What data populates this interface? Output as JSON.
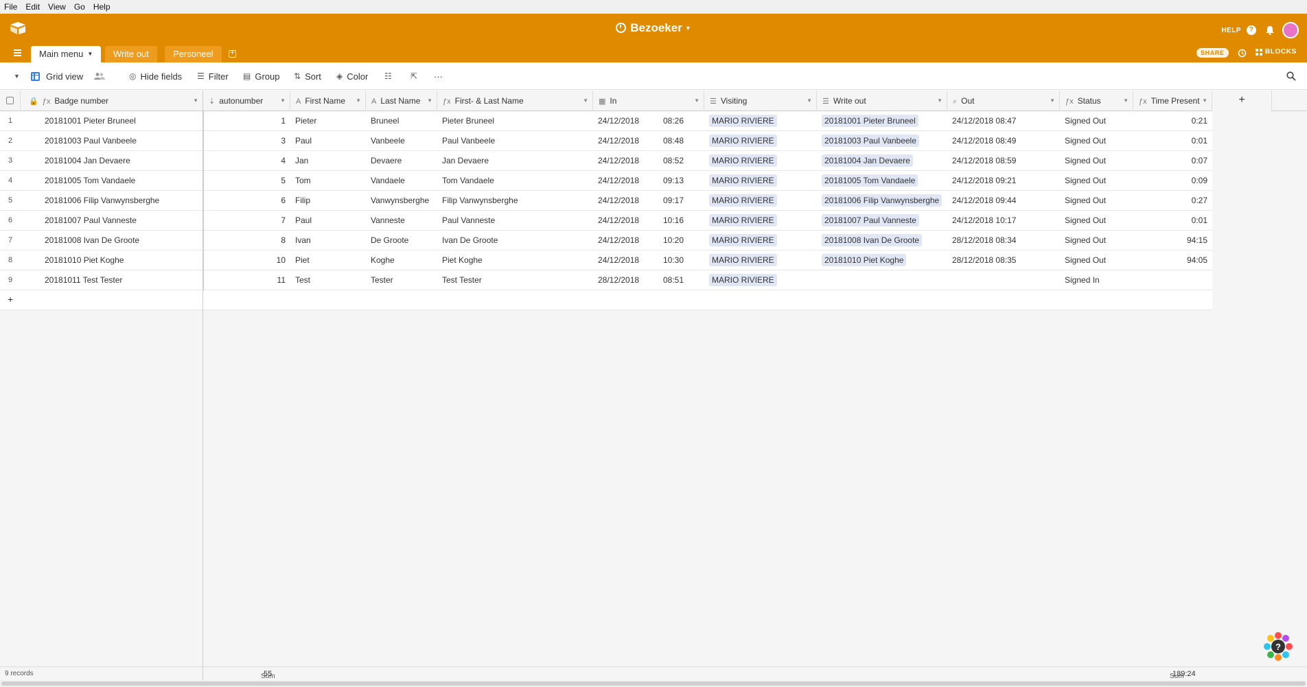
{
  "menubar": [
    "File",
    "Edit",
    "View",
    "Go",
    "Help"
  ],
  "header": {
    "base_name": "Bezoeker",
    "help_label": "HELP",
    "share_label": "SHARE",
    "blocks_label": "BLOCKS",
    "accent_color": "#e08a00"
  },
  "tabs": [
    {
      "label": "Main menu",
      "active": true
    },
    {
      "label": "Write out",
      "active": false
    },
    {
      "label": "Personeel",
      "active": false
    }
  ],
  "viewbar": {
    "view_name": "Grid view",
    "hide_fields": "Hide fields",
    "filter": "Filter",
    "group": "Group",
    "sort": "Sort",
    "color": "Color",
    "more": "···"
  },
  "columns": [
    {
      "label": "Badge number",
      "icon": "fx"
    },
    {
      "label": "autonumber",
      "icon": "autonumber"
    },
    {
      "label": "First Name",
      "icon": "A"
    },
    {
      "label": "Last Name",
      "icon": "A"
    },
    {
      "label": "First- & Last Name",
      "icon": "fx"
    },
    {
      "label": "In",
      "icon": "date"
    },
    {
      "label": "Visiting",
      "icon": "link"
    },
    {
      "label": "Write out",
      "icon": "link"
    },
    {
      "label": "Out",
      "icon": "lookup"
    },
    {
      "label": "Status",
      "icon": "fx"
    },
    {
      "label": "Time Present",
      "icon": "fx"
    }
  ],
  "rows": [
    {
      "n": "1",
      "badge": "20181001 Pieter Bruneel",
      "auto": "1",
      "first": "Pieter",
      "last": "Bruneel",
      "full": "Pieter Bruneel",
      "in_date": "24/12/2018",
      "in_time": "08:26",
      "visiting": "MARIO RIVIERE",
      "writeout": "20181001 Pieter Bruneel",
      "out": "24/12/2018 08:47",
      "status": "Signed Out",
      "present": "0:21"
    },
    {
      "n": "2",
      "badge": "20181003 Paul Vanbeele",
      "auto": "3",
      "first": "Paul",
      "last": "Vanbeele",
      "full": "Paul Vanbeele",
      "in_date": "24/12/2018",
      "in_time": "08:48",
      "visiting": "MARIO RIVIERE",
      "writeout": "20181003 Paul Vanbeele",
      "out": "24/12/2018 08:49",
      "status": "Signed Out",
      "present": "0:01"
    },
    {
      "n": "3",
      "badge": "20181004 Jan Devaere",
      "auto": "4",
      "first": "Jan",
      "last": "Devaere",
      "full": "Jan Devaere",
      "in_date": "24/12/2018",
      "in_time": "08:52",
      "visiting": "MARIO RIVIERE",
      "writeout": "20181004 Jan Devaere",
      "out": "24/12/2018 08:59",
      "status": "Signed Out",
      "present": "0:07"
    },
    {
      "n": "4",
      "badge": "20181005 Tom Vandaele",
      "auto": "5",
      "first": "Tom",
      "last": "Vandaele",
      "full": "Tom Vandaele",
      "in_date": "24/12/2018",
      "in_time": "09:13",
      "visiting": "MARIO RIVIERE",
      "writeout": "20181005 Tom Vandaele",
      "out": "24/12/2018 09:21",
      "status": "Signed Out",
      "present": "0:09"
    },
    {
      "n": "5",
      "badge": "20181006 Filip Vanwynsberghe",
      "auto": "6",
      "first": "Filip",
      "last": "Vanwynsberghe",
      "full": "Filip Vanwynsberghe",
      "in_date": "24/12/2018",
      "in_time": "09:17",
      "visiting": "MARIO RIVIERE",
      "writeout": "20181006 Filip Vanwynsberghe",
      "out": "24/12/2018 09:44",
      "status": "Signed Out",
      "present": "0:27"
    },
    {
      "n": "6",
      "badge": "20181007 Paul Vanneste",
      "auto": "7",
      "first": "Paul",
      "last": "Vanneste",
      "full": "Paul Vanneste",
      "in_date": "24/12/2018",
      "in_time": "10:16",
      "visiting": "MARIO RIVIERE",
      "writeout": "20181007 Paul Vanneste",
      "out": "24/12/2018 10:17",
      "status": "Signed Out",
      "present": "0:01"
    },
    {
      "n": "7",
      "badge": "20181008 Ivan De Groote",
      "auto": "8",
      "first": "Ivan",
      "last": "De Groote",
      "full": "Ivan De Groote",
      "in_date": "24/12/2018",
      "in_time": "10:20",
      "visiting": "MARIO RIVIERE",
      "writeout": "20181008 Ivan De Groote",
      "out": "28/12/2018 08:34",
      "status": "Signed Out",
      "present": "94:15"
    },
    {
      "n": "8",
      "badge": "20181010 Piet Koghe",
      "auto": "10",
      "first": "Piet",
      "last": "Koghe",
      "full": "Piet Koghe",
      "in_date": "24/12/2018",
      "in_time": "10:30",
      "visiting": "MARIO RIVIERE",
      "writeout": "20181010 Piet Koghe",
      "out": "28/12/2018 08:35",
      "status": "Signed Out",
      "present": "94:05"
    },
    {
      "n": "9",
      "badge": "20181011 Test Tester",
      "auto": "11",
      "first": "Test",
      "last": "Tester",
      "full": "Test Tester",
      "in_date": "28/12/2018",
      "in_time": "08:51",
      "visiting": "MARIO RIVIERE",
      "writeout": "",
      "out": "",
      "status": "Signed In",
      "present": ""
    }
  ],
  "footer": {
    "records": "9 records",
    "sum_label": "Sum",
    "sum_autonumber": "55",
    "sum_time": "189:24"
  }
}
